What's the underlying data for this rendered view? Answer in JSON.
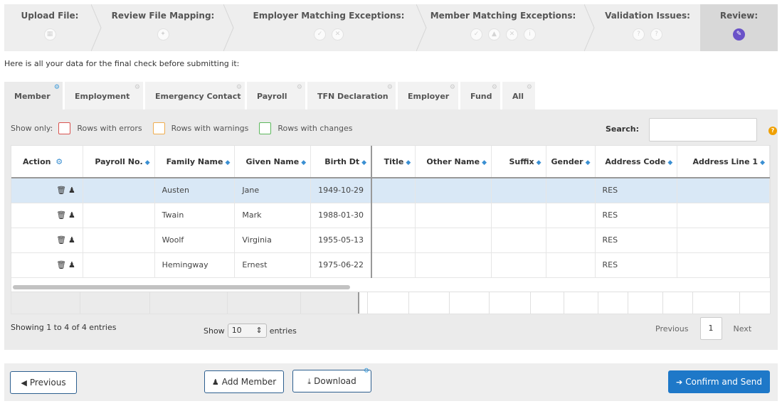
{
  "wizard": {
    "steps": [
      {
        "title": "Upload File:",
        "icons": [
          "calendar-icon"
        ]
      },
      {
        "title": "Review File Mapping:",
        "icons": [
          "rocket-icon"
        ]
      },
      {
        "title": "Employer Matching Exceptions:",
        "icons": [
          "check-icon",
          "x-icon"
        ]
      },
      {
        "title": "Member Matching Exceptions:",
        "icons": [
          "check-icon",
          "warning-icon",
          "x-icon",
          "info-icon"
        ]
      },
      {
        "title": "Validation Issues:",
        "icons": [
          "question-icon",
          "question-icon"
        ]
      },
      {
        "title": "Review:",
        "icons": [
          "edit-icon"
        ]
      }
    ],
    "active_step": 5
  },
  "intro_text": "Here is all your data for the final check before submitting it:",
  "tabs": [
    "Member",
    "Employment",
    "Emergency Contact",
    "Payroll",
    "TFN Declaration",
    "Employer",
    "Fund",
    "All"
  ],
  "active_tab": "Member",
  "filters": {
    "show_only_label": "Show only:",
    "errors_label": "Rows with errors",
    "warnings_label": "Rows with warnings",
    "changes_label": "Rows with changes",
    "errors_color": "#d9534f",
    "warnings_color": "#f0ad4e",
    "changes_color": "#5cb85c"
  },
  "search": {
    "label": "Search:",
    "value": ""
  },
  "table": {
    "columns": [
      "Action",
      "Payroll No.",
      "Family Name",
      "Given Name",
      "Birth Dt",
      "Title",
      "Other Name",
      "Suffix",
      "Gender",
      "Address Code",
      "Address Line 1"
    ],
    "rows": [
      {
        "payroll_no": "",
        "family_name": "Austen",
        "given_name": "Jane",
        "birth_dt": "1949-10-29",
        "title": "",
        "other_name": "",
        "suffix": "",
        "gender": "",
        "address_code": "RES",
        "address_line_1": ""
      },
      {
        "payroll_no": "",
        "family_name": "Twain",
        "given_name": "Mark",
        "birth_dt": "1988-01-30",
        "title": "",
        "other_name": "",
        "suffix": "",
        "gender": "",
        "address_code": "RES",
        "address_line_1": ""
      },
      {
        "payroll_no": "",
        "family_name": "Woolf",
        "given_name": "Virginia",
        "birth_dt": "1955-05-13",
        "title": "",
        "other_name": "",
        "suffix": "",
        "gender": "",
        "address_code": "RES",
        "address_line_1": ""
      },
      {
        "payroll_no": "",
        "family_name": "Hemingway",
        "given_name": "Ernest",
        "birth_dt": "1975-06-22",
        "title": "",
        "other_name": "",
        "suffix": "",
        "gender": "",
        "address_code": "RES",
        "address_line_1": ""
      }
    ],
    "selected_row": 0
  },
  "info_text": "Showing 1 to 4 of 4 entries",
  "length": {
    "show": "Show",
    "value": "10",
    "entries": "entries"
  },
  "pagination": {
    "previous": "Previous",
    "page": "1",
    "next": "Next"
  },
  "buttons": {
    "previous": "Previous",
    "add_member": "Add Member",
    "download": "Download",
    "confirm": "Confirm and Send"
  },
  "colors": {
    "accent": "#1e78c8",
    "active_step": "#6a52c8",
    "selected_row": "#d9e8f6",
    "sort_arrow": "#3a8fd2"
  }
}
